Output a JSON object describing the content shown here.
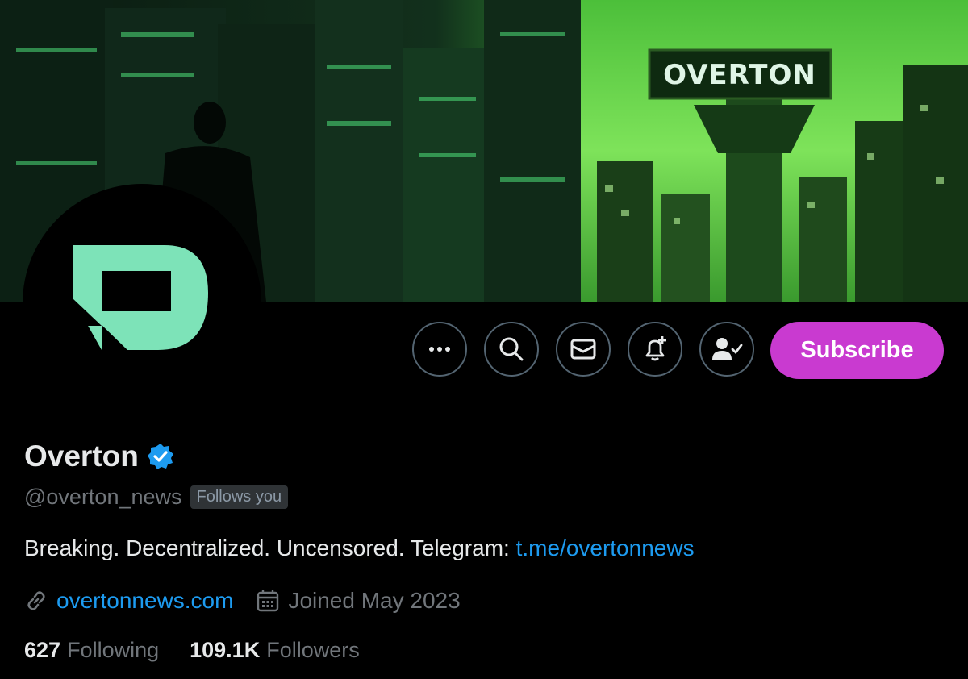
{
  "banner": {
    "sign_text": "OVERTON",
    "icon": "city-banner-image"
  },
  "avatar": {
    "icon": "overton-logo-icon",
    "brand_color": "#7de3b8"
  },
  "actions": {
    "more_icon": "more-horizontal-icon",
    "search_icon": "search-icon",
    "message_icon": "envelope-icon",
    "notify_icon": "bell-plus-icon",
    "follow_icon": "person-check-icon",
    "subscribe_label": "Subscribe",
    "subscribe_color": "#c93ad0"
  },
  "profile": {
    "name": "Overton",
    "verified_icon": "verified-badge-icon",
    "handle": "@overton_news",
    "follows_you": "Follows you",
    "bio_text": "Breaking. Decentralized. Uncensored. Telegram: ",
    "bio_link": "t.me/overtonnews",
    "website": "overtonnews.com",
    "joined": "Joined May 2023",
    "following_count": "627",
    "following_label": "Following",
    "followers_count": "109.1K",
    "followers_label": "Followers"
  },
  "colors": {
    "link": "#1d9bf0",
    "muted": "#71767b",
    "background": "#000000"
  }
}
